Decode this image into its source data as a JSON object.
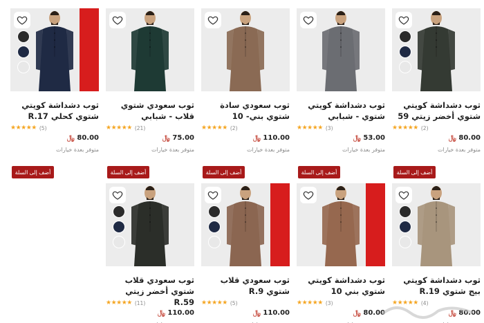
{
  "colors": {
    "accent": "#a81a1a",
    "star": "#f5a623",
    "currency": "#c0392b"
  },
  "icons": {
    "wishlist": "heart-icon",
    "currency": "riyal-icon"
  },
  "cart_label": "أضف إلى السلة",
  "availability": "متوفر بعدة خيارات",
  "products": [
    {
      "title": "ثوب دشداشة كويتي شتوي كحلي R.17",
      "reviews": "(5)",
      "price": "80.00",
      "robe": "#1f2a44",
      "bg": "red-right"
    },
    {
      "title": "ثوب سعودي شتوي قلاب - شبابي",
      "reviews": "(21)",
      "price": "75.00",
      "robe": "#1e3a34",
      "bg": "grey"
    },
    {
      "title": "ثوب سعودي سادة شتوي بني- 10",
      "reviews": "(2)",
      "price": "110.00",
      "robe": "#8a6a54",
      "bg": "grey"
    },
    {
      "title": "ثوب دشداشة كويتي شتوي - شبابي",
      "reviews": "(3)",
      "price": "53.00",
      "robe": "#6b6d72",
      "bg": "grey"
    },
    {
      "title": "ثوب دشداشة كويتي شتوي أخضر زيتي 59",
      "reviews": "(2)",
      "price": "80.00",
      "robe": "#343a33",
      "bg": "grey"
    },
    {
      "title": "ثوب سعودي قلاب شتوي أخضر زيتي R.59",
      "reviews": "(11)",
      "price": "110.00",
      "robe": "#2b2e29",
      "bg": "grey"
    },
    {
      "title": "ثوب سعودي قلاب شتوي R.9",
      "reviews": "(5)",
      "price": "110.00",
      "robe": "#8b6651",
      "bg": "red-right"
    },
    {
      "title": "ثوب دشداشة كويتي شتوي بني 10",
      "reviews": "(3)",
      "price": "80.00",
      "robe": "#96684f",
      "bg": "red-right"
    },
    {
      "title": "ثوب دشداشة كويتي بيج شتوي R.19",
      "reviews": "(4)",
      "price": "80.00",
      "robe": "#a8957d",
      "bg": "grey"
    }
  ]
}
